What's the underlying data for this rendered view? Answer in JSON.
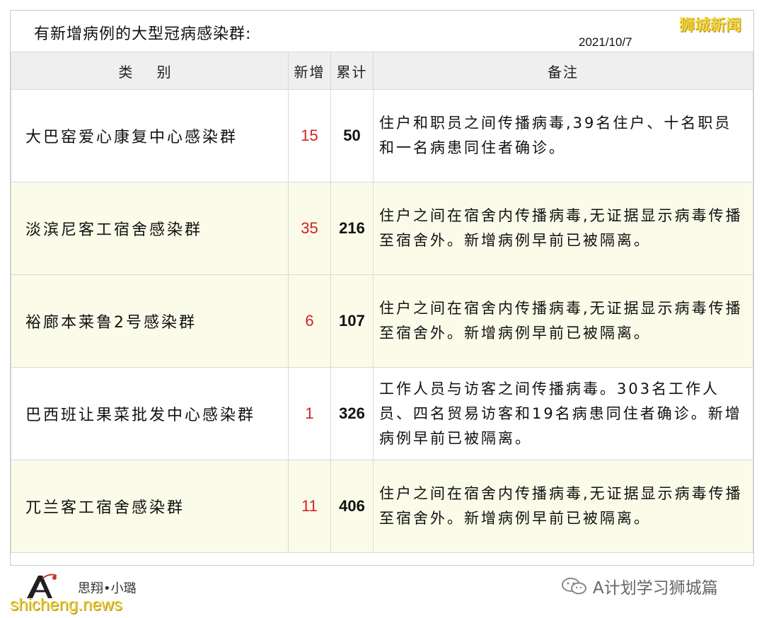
{
  "header": {
    "title": "有新增病例的大型冠病感染群:",
    "date": "2021/10/7",
    "corner_tag": "狮城新闻"
  },
  "table": {
    "headers": {
      "category": "类 别",
      "new": "新增",
      "total": "累计",
      "note": "备注"
    },
    "rows": [
      {
        "category": "大巴窑爱心康复中心感染群",
        "new": "15",
        "total": "50",
        "note": "住户和职员之间传播病毒,39名住户、十名职员和一名病患同住者确诊。"
      },
      {
        "category": "淡滨尼客工宿舍感染群",
        "new": "35",
        "total": "216",
        "note": "住户之间在宿舍内传播病毒,无证据显示病毒传播至宿舍外。新增病例早前已被隔离。"
      },
      {
        "category": "裕廊本莱鲁2号感染群",
        "new": "6",
        "total": "107",
        "note": "住户之间在宿舍内传播病毒,无证据显示病毒传播至宿舍外。新增病例早前已被隔离。"
      },
      {
        "category": "巴西班让果菜批发中心感染群",
        "new": "1",
        "total": "326",
        "note": "工作人员与访客之间传播病毒。303名工作人员、四名贸易访客和19名病患同住者确诊。新增病例早前已被隔离。"
      },
      {
        "category": "兀兰客工宿舍感染群",
        "new": "11",
        "total": "406",
        "note": "住户之间在宿舍内传播病毒,无证据显示病毒传播至宿舍外。新增病例早前已被隔离。"
      }
    ]
  },
  "footer": {
    "author": "思翔•小璐",
    "site": "shicheng.news",
    "wechat_account": "A计划学习狮城篇",
    "logo_icon": "a-plan-logo-icon",
    "wechat_icon": "wechat-icon"
  },
  "colors": {
    "new_cases": "#d42020",
    "row_alt": "#fbfbea",
    "header_bg": "#efefef",
    "tag_yellow": "#f5d33a"
  }
}
